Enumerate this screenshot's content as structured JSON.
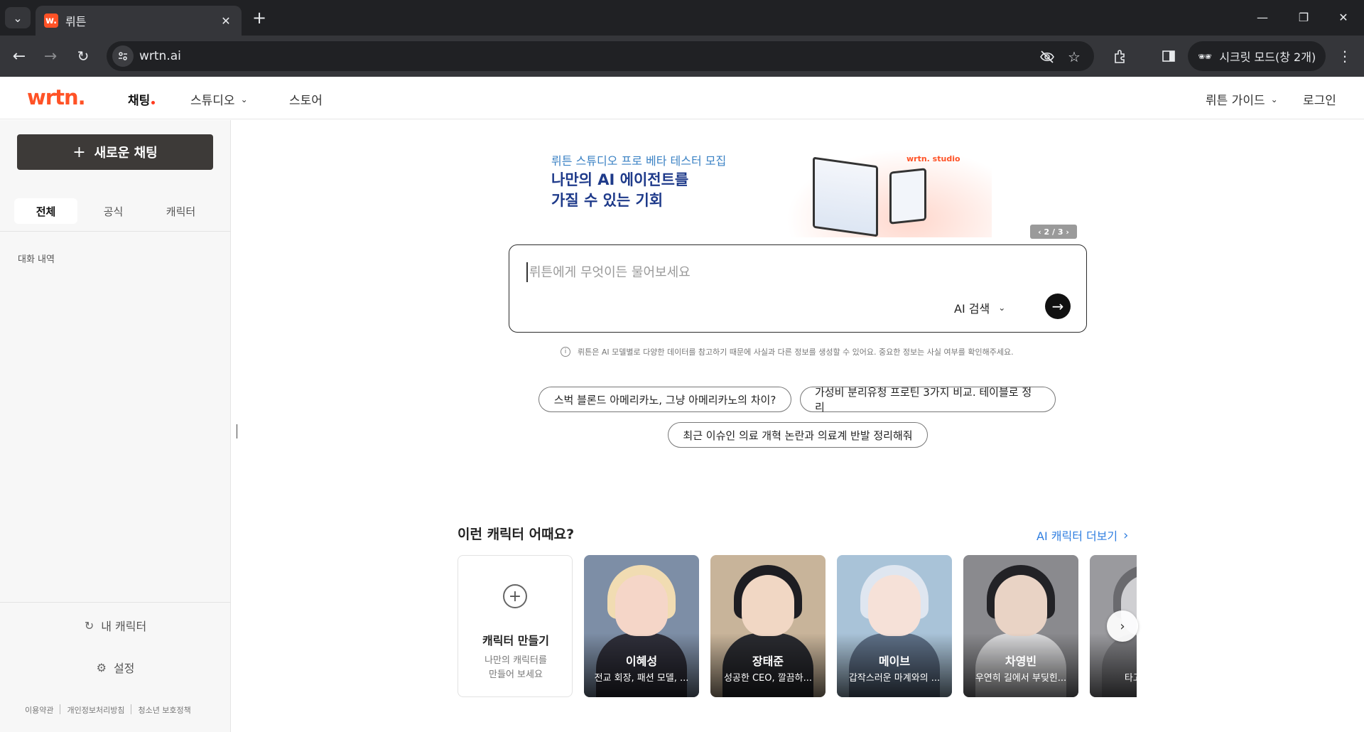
{
  "browser": {
    "tab_title": "뤼튼",
    "favicon_text": "w.",
    "url": "wrtn.ai",
    "incognito_label": "시크릿 모드(창 2개)"
  },
  "header": {
    "logo": "wrtn.",
    "nav": [
      {
        "label": "채팅"
      },
      {
        "label": "스튜디오"
      },
      {
        "label": "스토어"
      }
    ],
    "guide_label": "뤼튼 가이드",
    "login_label": "로그인"
  },
  "sidebar": {
    "new_chat_label": "새로운 채팅",
    "filters": [
      "전체",
      "공식",
      "캐릭터"
    ],
    "history_label": "대화 내역",
    "my_character_label": "내 캐릭터",
    "settings_label": "설정",
    "footer_links": [
      "이용약관",
      "개인정보처리방침",
      "청소년 보호정책"
    ]
  },
  "banner": {
    "subtitle": "뤼튼 스튜디오 프로 베타 테스터 모집",
    "title_line1": "나만의 AI 에이전트를",
    "title_line2": "가질 수 있는 기회",
    "studio_logo": "wrtn. studio",
    "pager": "‹ 2 / 3 ›"
  },
  "ask": {
    "placeholder": "뤼튼에게 무엇이든 물어보세요",
    "mode_label": "AI 검색",
    "disclaimer": "뤼튼은 AI 모델별로 다양한 데이터를 참고하기 때문에 사실과 다른 정보를 생성할 수 있어요. 중요한 정보는 사실 여부를 확인해주세요."
  },
  "suggestions": [
    "스벅 블론드 아메리카노, 그냥 아메리카노의 차이?",
    "가성비 분리유청 프로틴 3가지 비교. 테이블로 정리",
    "최근 이슈인 의료 개혁 논란과 의료계 반발 정리해줘"
  ],
  "characters_section": {
    "title": "이런 캐릭터 어때요?",
    "more_label": "AI 캐릭터 더보기",
    "create_card": {
      "title": "캐릭터 만들기",
      "desc_line1": "나만의 캐릭터를",
      "desc_line2": "만들어 보세요"
    },
    "characters": [
      {
        "name": "이혜성",
        "desc": "전교 회장, 패션 모델, ...",
        "bg": "#7d8ea6",
        "hair": "#f1dcb2",
        "skin": "#f5d6c8",
        "cloth": "#2f2f3a"
      },
      {
        "name": "장태준",
        "desc": "성공한 CEO, 깔끔하...",
        "bg": "#c8b49a",
        "hair": "#1d1d22",
        "skin": "#f1d7c4",
        "cloth": "#2a2b30"
      },
      {
        "name": "메이브",
        "desc": "갑작스러운 마계와의 ...",
        "bg": "#a9c3d8",
        "hair": "#dfe6f0",
        "skin": "#f6e1d8",
        "cloth": "#5d6f86"
      },
      {
        "name": "차영빈",
        "desc": "우연히 길에서 부딪힌...",
        "bg": "#8a8a8e",
        "hair": "#222226",
        "skin": "#e9d3c5",
        "cloth": "#d9d9db"
      },
      {
        "name": "",
        "desc": "타고난 여...",
        "bg": "#9a9a9e",
        "hair": "#6a6a6e",
        "skin": "#cfcfd2",
        "cloth": "#7c7c80"
      }
    ]
  }
}
